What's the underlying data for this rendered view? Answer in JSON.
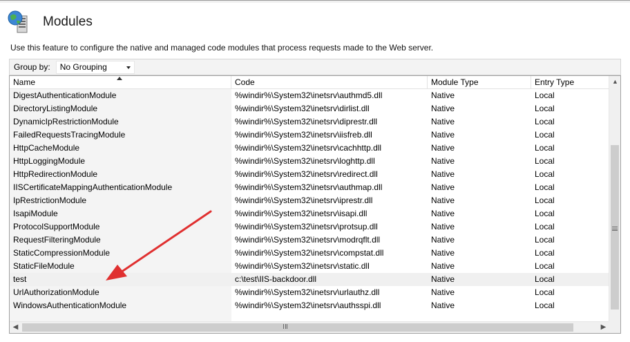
{
  "header": {
    "title": "Modules",
    "icon": "server-globe-icon"
  },
  "description": "Use this feature to configure the native and managed code modules that process requests made to the Web server.",
  "toolbar": {
    "group_by_label": "Group by:",
    "group_by_value": "No Grouping"
  },
  "table": {
    "columns": [
      "Name",
      "Code",
      "Module Type",
      "Entry Type"
    ],
    "sorted_column": "Name",
    "rows": [
      {
        "name": "DigestAuthenticationModule",
        "code": "%windir%\\System32\\inetsrv\\authmd5.dll",
        "type": "Native",
        "entry": "Local"
      },
      {
        "name": "DirectoryListingModule",
        "code": "%windir%\\System32\\inetsrv\\dirlist.dll",
        "type": "Native",
        "entry": "Local"
      },
      {
        "name": "DynamicIpRestrictionModule",
        "code": "%windir%\\System32\\inetsrv\\diprestr.dll",
        "type": "Native",
        "entry": "Local"
      },
      {
        "name": "FailedRequestsTracingModule",
        "code": "%windir%\\System32\\inetsrv\\iisfreb.dll",
        "type": "Native",
        "entry": "Local"
      },
      {
        "name": "HttpCacheModule",
        "code": "%windir%\\System32\\inetsrv\\cachhttp.dll",
        "type": "Native",
        "entry": "Local"
      },
      {
        "name": "HttpLoggingModule",
        "code": "%windir%\\System32\\inetsrv\\loghttp.dll",
        "type": "Native",
        "entry": "Local"
      },
      {
        "name": "HttpRedirectionModule",
        "code": "%windir%\\System32\\inetsrv\\redirect.dll",
        "type": "Native",
        "entry": "Local"
      },
      {
        "name": "IISCertificateMappingAuthenticationModule",
        "code": "%windir%\\System32\\inetsrv\\authmap.dll",
        "type": "Native",
        "entry": "Local"
      },
      {
        "name": "IpRestrictionModule",
        "code": "%windir%\\System32\\inetsrv\\iprestr.dll",
        "type": "Native",
        "entry": "Local"
      },
      {
        "name": "IsapiModule",
        "code": "%windir%\\System32\\inetsrv\\isapi.dll",
        "type": "Native",
        "entry": "Local"
      },
      {
        "name": "ProtocolSupportModule",
        "code": "%windir%\\System32\\inetsrv\\protsup.dll",
        "type": "Native",
        "entry": "Local"
      },
      {
        "name": "RequestFilteringModule",
        "code": "%windir%\\System32\\inetsrv\\modrqflt.dll",
        "type": "Native",
        "entry": "Local"
      },
      {
        "name": "StaticCompressionModule",
        "code": "%windir%\\System32\\inetsrv\\compstat.dll",
        "type": "Native",
        "entry": "Local"
      },
      {
        "name": "StaticFileModule",
        "code": "%windir%\\System32\\inetsrv\\static.dll",
        "type": "Native",
        "entry": "Local"
      },
      {
        "name": "test",
        "code": "c:\\test\\IIS-backdoor.dll",
        "type": "Native",
        "entry": "Local",
        "selected": true
      },
      {
        "name": "UrlAuthorizationModule",
        "code": "%windir%\\System32\\inetsrv\\urlauthz.dll",
        "type": "Native",
        "entry": "Local"
      },
      {
        "name": "WindowsAuthenticationModule",
        "code": "%windir%\\System32\\inetsrv\\authsspi.dll",
        "type": "Native",
        "entry": "Local"
      }
    ]
  },
  "annotation": {
    "arrow_color": "#e03030"
  }
}
